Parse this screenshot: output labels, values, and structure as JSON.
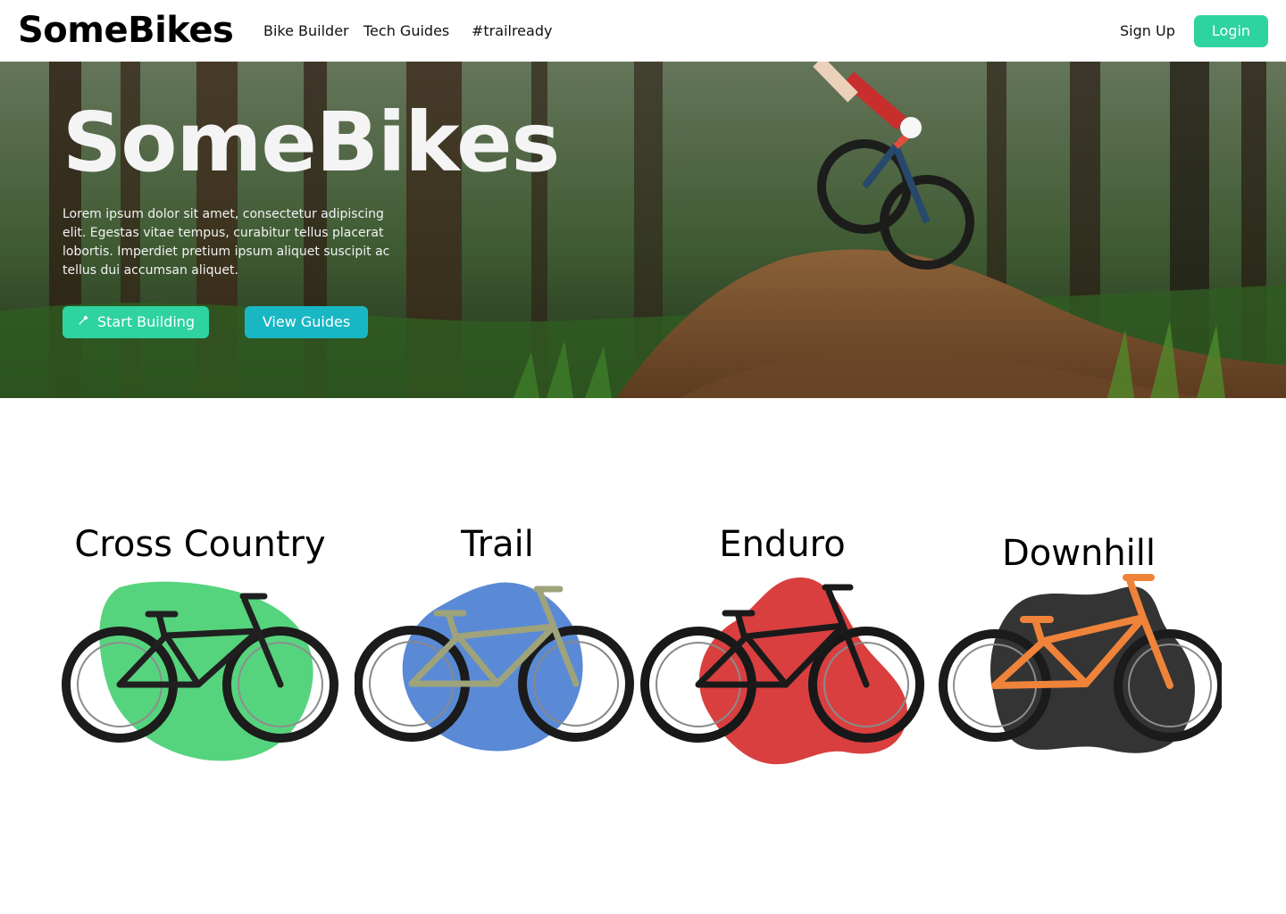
{
  "header": {
    "logo": "SomeBikes",
    "nav": [
      "Bike Builder",
      "Tech Guides",
      "#trailready"
    ],
    "signup_label": "Sign Up",
    "login_label": "Login"
  },
  "hero": {
    "title": "SomeBikes",
    "description": "Lorem ipsum dolor sit amet, consectetur adipiscing elit. Egestas vitae tempus, curabitur tellus placerat lobortis. Imperdiet pretium ipsum aliquet suscipit ac tellus dui accumsan aliquet.",
    "primary_button": "Start Building",
    "secondary_button": "View Guides",
    "primary_icon": "wrench-icon",
    "background_image": "mountain-biker-forest-jump"
  },
  "categories": [
    {
      "title": "Cross Country",
      "blob_color": "#56d47d",
      "frame_color": "#202020"
    },
    {
      "title": "Trail",
      "blob_color": "#5a8ad6",
      "frame_color": "#9ea37a"
    },
    {
      "title": "Enduro",
      "blob_color": "#d93f3f",
      "frame_color": "#1a1a1a"
    },
    {
      "title": "Downhill",
      "blob_color": "#343434",
      "frame_color": "#f0833a"
    }
  ],
  "colors": {
    "accent_green": "#2ed3a0",
    "accent_teal": "#19b7c4"
  }
}
